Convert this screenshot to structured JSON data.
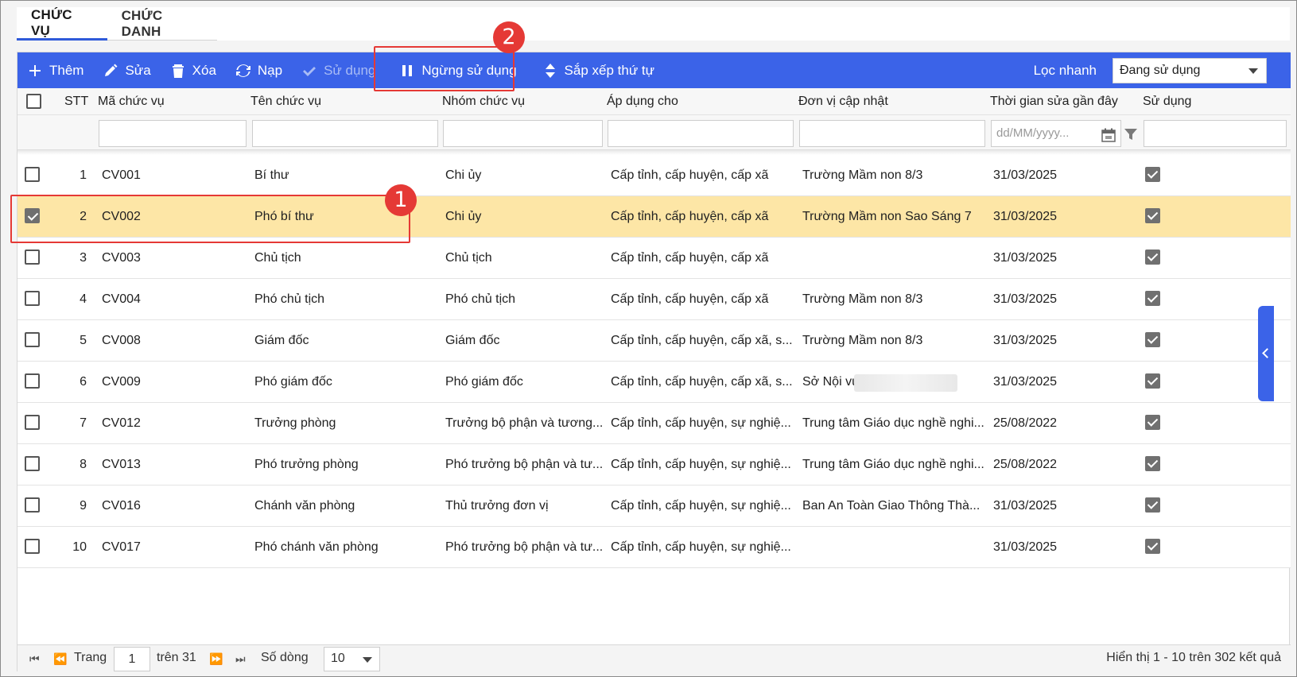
{
  "tabs": [
    {
      "label": "CHỨC VỤ",
      "active": true
    },
    {
      "label": "CHỨC DANH",
      "active": false
    }
  ],
  "toolbar": {
    "add": "Thêm",
    "edit": "Sửa",
    "delete": "Xóa",
    "reload": "Nạp",
    "use": "Sử dụng",
    "stop_use": "Ngừng sử dụng",
    "sort": "Sắp xếp thứ tự",
    "quick_filter_label": "Lọc nhanh",
    "quick_filter_value": "Đang sử dụng"
  },
  "columns": {
    "stt": "STT",
    "code": "Mã chức vụ",
    "name": "Tên chức vụ",
    "group": "Nhóm chức vụ",
    "apply": "Áp dụng cho",
    "unit": "Đơn vị cập nhật",
    "updated": "Thời gian sửa gần đây",
    "in_use": "Sử dụng"
  },
  "filters": {
    "date_placeholder": "dd/MM/yyyy..."
  },
  "rows": [
    {
      "stt": "1",
      "code": "CV001",
      "name": "Bí thư",
      "group": "Chi ủy",
      "apply": "Cấp tỉnh, cấp huyện, cấp xã",
      "unit": "Trường Mầm non 8/3",
      "updated": "31/03/2025",
      "selected": false
    },
    {
      "stt": "2",
      "code": "CV002",
      "name": "Phó bí thư",
      "group": "Chi ủy",
      "apply": "Cấp tỉnh, cấp huyện, cấp xã",
      "unit": "Trường Mầm non Sao Sáng 7",
      "updated": "31/03/2025",
      "selected": true
    },
    {
      "stt": "3",
      "code": "CV003",
      "name": "Chủ tịch",
      "group": "Chủ tịch",
      "apply": "Cấp tỉnh, cấp huyện, cấp xã",
      "unit": "",
      "updated": "31/03/2025",
      "selected": false
    },
    {
      "stt": "4",
      "code": "CV004",
      "name": "Phó chủ tịch",
      "group": "Phó chủ tịch",
      "apply": "Cấp tỉnh, cấp huyện, cấp xã",
      "unit": "Trường Mầm non 8/3",
      "updated": "31/03/2025",
      "selected": false
    },
    {
      "stt": "5",
      "code": "CV008",
      "name": "Giám đốc",
      "group": "Giám đốc",
      "apply": "Cấp tỉnh, cấp huyện, cấp xã, s...",
      "unit": "Trường Mầm non 8/3",
      "updated": "31/03/2025",
      "selected": false
    },
    {
      "stt": "6",
      "code": "CV009",
      "name": "Phó giám đốc",
      "group": "Phó giám đốc",
      "apply": "Cấp tỉnh, cấp huyện, cấp xã, s...",
      "unit": "Sở Nội vụ",
      "updated": "31/03/2025",
      "selected": false
    },
    {
      "stt": "7",
      "code": "CV012",
      "name": "Trưởng phòng",
      "group": "Trưởng bộ phận và tương...",
      "apply": "Cấp tỉnh, cấp huyện, sự nghiệ...",
      "unit": "Trung tâm Giáo dục nghề nghi...",
      "updated": "25/08/2022",
      "selected": false
    },
    {
      "stt": "8",
      "code": "CV013",
      "name": "Phó trưởng phòng",
      "group": "Phó trưởng bộ phận và tư...",
      "apply": "Cấp tỉnh, cấp huyện, sự nghiệ...",
      "unit": "Trung tâm Giáo dục nghề nghi...",
      "updated": "25/08/2022",
      "selected": false
    },
    {
      "stt": "9",
      "code": "CV016",
      "name": "Chánh văn phòng",
      "group": "Thủ trưởng đơn vị",
      "apply": "Cấp tỉnh, cấp huyện, sự nghiệ...",
      "unit": "Ban An Toàn Giao Thông Thà...",
      "updated": "31/03/2025",
      "selected": false
    },
    {
      "stt": "10",
      "code": "CV017",
      "name": "Phó chánh văn phòng",
      "group": "Phó trưởng bộ phận và tư...",
      "apply": "Cấp tỉnh, cấp huyện, sự nghiệ...",
      "unit": "",
      "updated": "31/03/2025",
      "selected": false
    }
  ],
  "pagination": {
    "page_label": "Trang",
    "page": "1",
    "of_label": "trên 31",
    "rows_label": "Số dòng",
    "rows_per_page": "10",
    "summary": "Hiển thị 1 - 10 trên 302 kết quả"
  },
  "annotations": {
    "badge1": "1",
    "badge2": "2"
  }
}
